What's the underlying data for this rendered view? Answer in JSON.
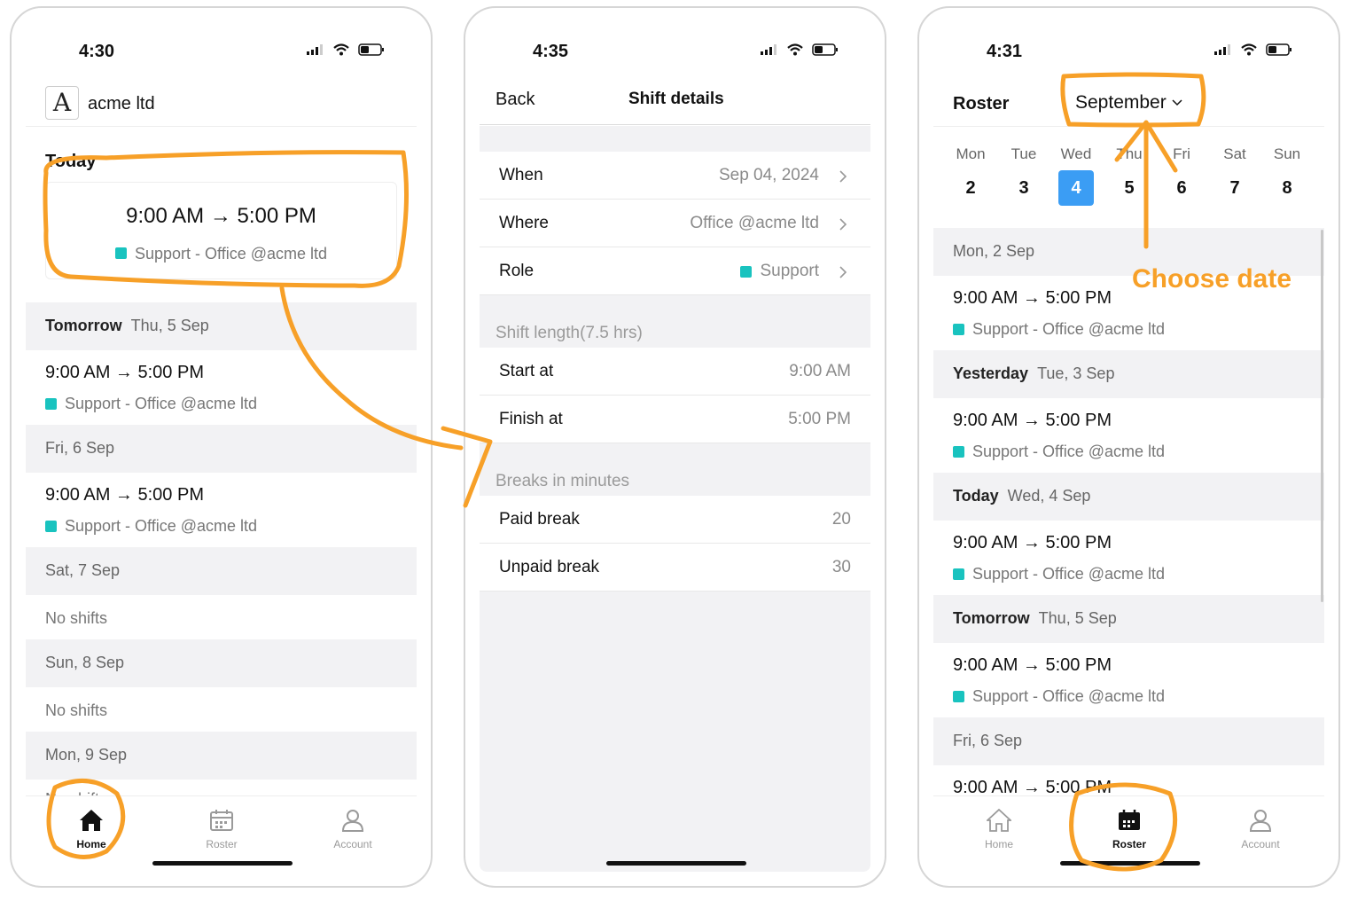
{
  "phone1": {
    "status_time": "4:30",
    "company": "acme ltd",
    "today_label": "Today",
    "today_shift": {
      "time": "9:00 AM → 5:00 PM",
      "detail": "Support - Office @acme ltd"
    },
    "sections": [
      {
        "bold": "Tomorrow",
        "text": "Thu, 5 Sep"
      },
      {
        "bold": "",
        "text": "Fri, 6 Sep"
      },
      {
        "bold": "",
        "text": "Sat, 7 Sep"
      },
      {
        "bold": "",
        "text": "Sun, 8 Sep"
      },
      {
        "bold": "",
        "text": "Mon, 9 Sep"
      }
    ],
    "shift_time": "9:00 AM → 5:00 PM",
    "shift_detail": "Support - Office @acme ltd",
    "no_shifts": "No shifts",
    "tabs": {
      "home": "Home",
      "roster": "Roster",
      "account": "Account"
    }
  },
  "phone2": {
    "status_time": "4:35",
    "back": "Back",
    "title": "Shift details",
    "when_label": "When",
    "when_value": "Sep 04, 2024",
    "where_label": "Where",
    "where_value": "Office @acme ltd",
    "role_label": "Role",
    "role_value": "Support",
    "shift_length_label": "Shift length(7.5 hrs)",
    "start_label": "Start at",
    "start_value": "9:00 AM",
    "finish_label": "Finish at",
    "finish_value": "5:00 PM",
    "breaks_label": "Breaks in minutes",
    "paid_label": "Paid break",
    "paid_value": "20",
    "unpaid_label": "Unpaid break",
    "unpaid_value": "30"
  },
  "phone3": {
    "status_time": "4:31",
    "title": "Roster",
    "month": "September",
    "days": [
      {
        "name": "Mon",
        "num": "2"
      },
      {
        "name": "Tue",
        "num": "3"
      },
      {
        "name": "Wed",
        "num": "4"
      },
      {
        "name": "Thu",
        "num": "5"
      },
      {
        "name": "Fri",
        "num": "6"
      },
      {
        "name": "Sat",
        "num": "7"
      },
      {
        "name": "Sun",
        "num": "8"
      }
    ],
    "sections": [
      {
        "bold": "",
        "text": "Mon, 2 Sep"
      },
      {
        "bold": "Yesterday",
        "text": "Tue, 3 Sep"
      },
      {
        "bold": "Today",
        "text": "Wed, 4 Sep"
      },
      {
        "bold": "Tomorrow",
        "text": "Thu, 5 Sep"
      },
      {
        "bold": "",
        "text": "Fri, 6 Sep"
      }
    ],
    "shift_time": "9:00 AM → 5:00 PM",
    "shift_detail": "Support - Office @acme ltd",
    "tabs": {
      "home": "Home",
      "roster": "Roster",
      "account": "Account"
    }
  },
  "annotation": {
    "choose_date": "Choose date",
    "color": "#f7a028"
  },
  "colors": {
    "accent_blue": "#3b9df4",
    "role_teal": "#19c3bf"
  }
}
